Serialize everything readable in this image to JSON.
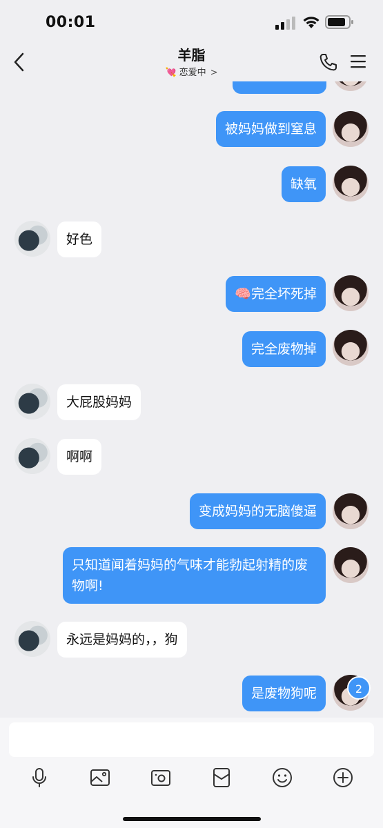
{
  "status_bar": {
    "time": "00:01"
  },
  "header": {
    "title": "羊脂",
    "subtitle_emoji": "💘",
    "subtitle": "恋爱中",
    "subtitle_chevron": ">"
  },
  "messages": [
    {
      "side": "out",
      "text": "被妈妈做到窒息"
    },
    {
      "side": "out",
      "text": "缺氧"
    },
    {
      "side": "in",
      "text": "好色"
    },
    {
      "side": "out",
      "emoji": "🧠",
      "text": "完全坏死掉"
    },
    {
      "side": "out",
      "text": "完全废物掉"
    },
    {
      "side": "in",
      "text": "大屁股妈妈"
    },
    {
      "side": "in",
      "text": "啊啊"
    },
    {
      "side": "out",
      "text": "变成妈妈的无脑傻逼"
    },
    {
      "side": "out",
      "text": "只知道闻着妈妈的气味才能勃起射精的废物啊!"
    },
    {
      "side": "in",
      "text": "永远是妈妈的，，狗"
    },
    {
      "side": "out",
      "text": "是废物狗呢",
      "badge": "2"
    }
  ],
  "toolbar": {
    "icons": [
      "microphone-icon",
      "image-icon",
      "camera-icon",
      "red-packet-icon",
      "emoji-icon",
      "plus-icon"
    ]
  },
  "colors": {
    "bubble_out": "#3f95f7",
    "bubble_in": "#ffffff",
    "background": "#efeff2"
  }
}
